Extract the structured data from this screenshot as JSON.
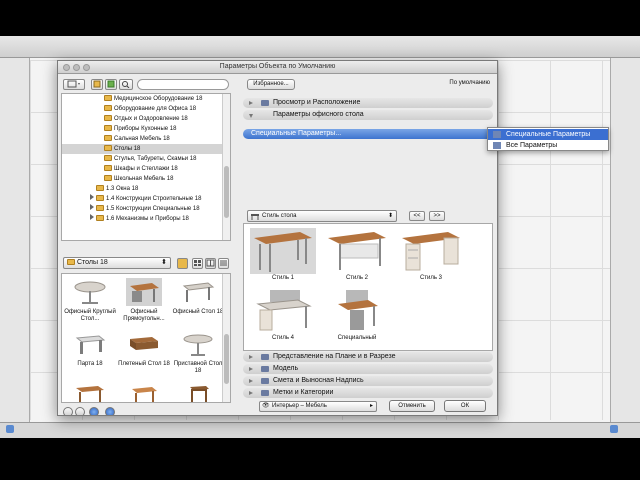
{
  "dialog": {
    "title": "Параметры Объекта по Умолчанию"
  },
  "library_tree": {
    "items": [
      {
        "label": "Медицинское Оборудование 18",
        "indent": 2,
        "expandable": false,
        "selected": false
      },
      {
        "label": "Оборудование для Офиса 18",
        "indent": 2,
        "expandable": false,
        "selected": false
      },
      {
        "label": "Отдых и Оздоровление 18",
        "indent": 2,
        "expandable": false,
        "selected": false
      },
      {
        "label": "Приборы Кухонные 18",
        "indent": 2,
        "expandable": false,
        "selected": false
      },
      {
        "label": "Сальная Мебель 18",
        "indent": 2,
        "expandable": false,
        "selected": false
      },
      {
        "label": "Столы 18",
        "indent": 2,
        "expandable": false,
        "selected": true
      },
      {
        "label": "Стулья, Табуреты, Скамьи 18",
        "indent": 2,
        "expandable": false,
        "selected": false
      },
      {
        "label": "Шкафы и Стеллажи 18",
        "indent": 2,
        "expandable": false,
        "selected": false
      },
      {
        "label": "Школьная Мебель 18",
        "indent": 2,
        "expandable": false,
        "selected": false
      },
      {
        "label": "1.3 Окна 18",
        "indent": 1,
        "expandable": false,
        "selected": false
      },
      {
        "label": "1.4 Конструкции Строительные 18",
        "indent": 1,
        "expandable": true,
        "selected": false
      },
      {
        "label": "1.5 Конструкции Специальные 18",
        "indent": 1,
        "expandable": true,
        "selected": false
      },
      {
        "label": "1.6 Механизмы и Приборы 18",
        "indent": 1,
        "expandable": true,
        "selected": false
      }
    ]
  },
  "library": {
    "folder_label": "Столы 18",
    "items": [
      {
        "label": "Офисный Круглый Стол...",
        "selected": false
      },
      {
        "label": "Офисный Прямоугольн...",
        "selected": true
      },
      {
        "label": "Офисный Стол 18",
        "selected": false
      },
      {
        "label": "Парта 18",
        "selected": false
      },
      {
        "label": "Плетеный Стол 18",
        "selected": false
      },
      {
        "label": "Приставной Стол 18",
        "selected": false
      },
      {
        "label": "",
        "selected": false
      },
      {
        "label": "",
        "selected": false
      },
      {
        "label": "",
        "selected": false
      }
    ]
  },
  "toolbar": {
    "favorites_label": "Избранное...",
    "default_label": "По умолчанию"
  },
  "sections_top": [
    {
      "label": "Просмотр и Расположение",
      "expanded": false
    },
    {
      "label": "Параметры офисного стола",
      "expanded": true
    }
  ],
  "special_params_label": "Специальные Параметры...",
  "style_selector": {
    "value": "Стиль стола",
    "prev": "<<",
    "next": ">>"
  },
  "styles": [
    {
      "label": "Стиль 1",
      "selected": true
    },
    {
      "label": "Стиль 2",
      "selected": false
    },
    {
      "label": "Стиль 3",
      "selected": false
    },
    {
      "label": "Стиль 4",
      "selected": false
    },
    {
      "label": "Специальный",
      "selected": false
    }
  ],
  "sections_bottom": [
    {
      "label": "Представление на Плане и в Разрезе"
    },
    {
      "label": "Модель"
    },
    {
      "label": "Смета и Выносная Надпись"
    },
    {
      "label": "Метки и Категории"
    }
  ],
  "footer": {
    "layer_value": "Интерьер – Мебель",
    "cancel_label": "Отменить",
    "ok_label": "ОК"
  },
  "popup_menu": {
    "items": [
      {
        "label": "Специальные Параметры",
        "selected": true
      },
      {
        "label": "Все Параметры",
        "selected": false
      }
    ]
  },
  "colors": {
    "selection_blue": "#3b6fd1",
    "folder_yellow": "#e8b84a",
    "table_top_wood": "#b4733e"
  }
}
